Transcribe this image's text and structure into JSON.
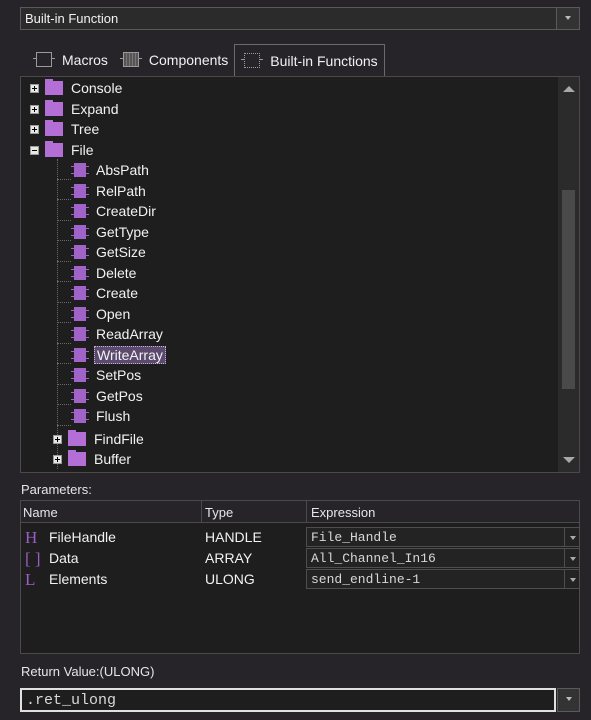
{
  "function_select": {
    "value": "Built-in Function"
  },
  "tabs": [
    {
      "label": "Macros",
      "icon": "macro-icon"
    },
    {
      "label": "Components",
      "icon": "component-icon"
    },
    {
      "label": "Built-in Functions",
      "icon": "builtin-function-icon",
      "active": true
    }
  ],
  "tree": {
    "folders_top": [
      {
        "label": "Console",
        "state": "collapsed"
      },
      {
        "label": "Expand",
        "state": "collapsed"
      },
      {
        "label": "Tree",
        "state": "collapsed"
      },
      {
        "label": "File",
        "state": "expanded"
      }
    ],
    "file_functions": [
      "AbsPath",
      "RelPath",
      "CreateDir",
      "GetType",
      "GetSize",
      "Delete",
      "Create",
      "Open",
      "ReadArray",
      "WriteArray",
      "SetPos",
      "GetPos",
      "Flush"
    ],
    "selected": "WriteArray",
    "subfolders": [
      {
        "label": "FindFile",
        "state": "collapsed"
      },
      {
        "label": "Buffer",
        "state": "collapsed"
      }
    ]
  },
  "parameters": {
    "label": "Parameters:",
    "columns": [
      "Name",
      "Type",
      "Expression"
    ],
    "rows": [
      {
        "icon": "H",
        "name": "FileHandle",
        "type": "HANDLE",
        "expression": "File_Handle"
      },
      {
        "icon": "[ ]",
        "name": "Data",
        "type": "ARRAY",
        "expression": "All_Channel_In16"
      },
      {
        "icon": "L",
        "name": "Elements",
        "type": "ULONG",
        "expression": "send_endline-1"
      }
    ]
  },
  "return_value": {
    "label": "Return Value:(ULONG)",
    "value": ".ret_ulong"
  },
  "colors": {
    "accent": "#a063c8",
    "background": "#262329",
    "panel": "#1e1e1e"
  }
}
